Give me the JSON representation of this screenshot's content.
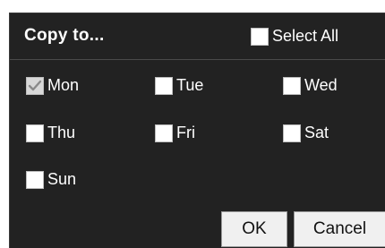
{
  "dialog": {
    "title": "Copy to...",
    "select_all": {
      "label": "Select All",
      "checked": false
    },
    "days": [
      {
        "label": "Mon",
        "checked": true
      },
      {
        "label": "Tue",
        "checked": false
      },
      {
        "label": "Wed",
        "checked": false
      },
      {
        "label": "Thu",
        "checked": false
      },
      {
        "label": "Fri",
        "checked": false
      },
      {
        "label": "Sat",
        "checked": false
      },
      {
        "label": "Sun",
        "checked": false
      }
    ],
    "buttons": {
      "ok": "OK",
      "cancel": "Cancel"
    }
  },
  "colors": {
    "background": "#222222",
    "text": "#ffffff",
    "button_bg": "#f0f0f0"
  }
}
